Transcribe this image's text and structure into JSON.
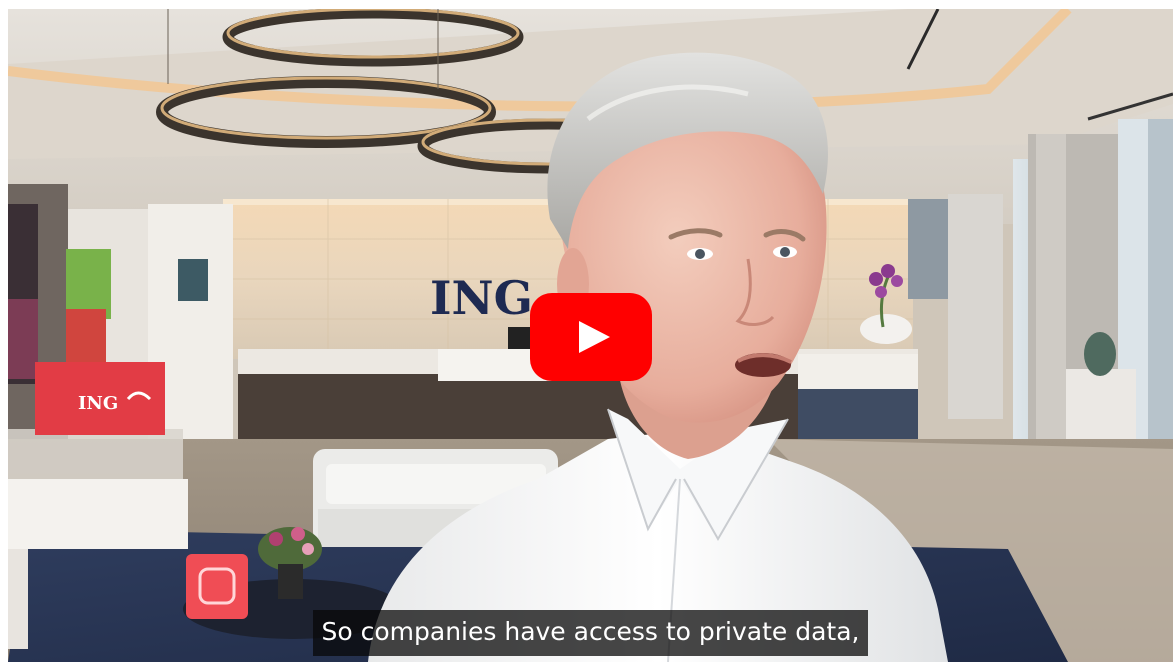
{
  "video": {
    "caption": "So companies have access to private data,",
    "wall_logo": "ING",
    "box_logo": "ING",
    "play_icon": "youtube-play-icon",
    "colors": {
      "youtube_red": "#ff0000",
      "ing_orange": "#ff6200",
      "wall_logo_navy": "#1e2a52",
      "caption_bg": "#141414"
    }
  }
}
